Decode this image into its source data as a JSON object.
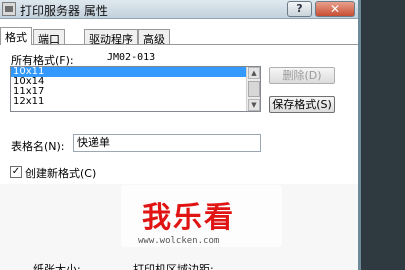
{
  "window": {
    "title": "打印服务器 属性",
    "help_label": "?",
    "close_label": "✕"
  },
  "tabs": [
    {
      "label": "格式",
      "active": true
    },
    {
      "label": "端口",
      "active": false
    },
    {
      "label": "驱动程序",
      "active": false
    },
    {
      "label": "高级",
      "active": false
    }
  ],
  "formats": {
    "label": "所有格式(F):",
    "id": "JM02-013",
    "items": [
      "10x11",
      "10x14",
      "11x17",
      "12x11"
    ],
    "selected_index": 0
  },
  "buttons": {
    "delete": "删除(D)",
    "save": "保存格式(S)"
  },
  "table_name": {
    "label": "表格名(N):",
    "value": "快递单"
  },
  "create_new": {
    "label": "创建新格式(C)",
    "checked": true
  },
  "bottom_labels": {
    "paper_size": "纸张大小:",
    "print_area": "打印机区域边距:"
  },
  "watermark": {
    "logo": "我乐看",
    "url": "www.wolcken.com"
  },
  "colors": {
    "selection": "#3399ff",
    "close_button": "#c74e32",
    "watermark": "#e11414"
  }
}
